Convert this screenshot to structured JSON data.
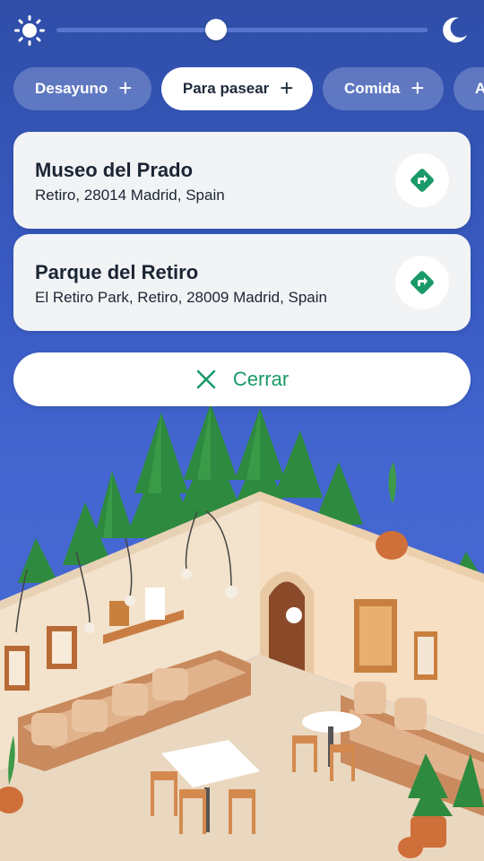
{
  "theme": {
    "accent": "#1a9a68",
    "sun_icon": "sun-icon",
    "moon_icon": "moon-icon",
    "brightness_level": 0.43
  },
  "chips": [
    {
      "label": "Desayuno",
      "active": false
    },
    {
      "label": "Para pasear",
      "active": true
    },
    {
      "label": "Comida",
      "active": false
    },
    {
      "label": "Ape",
      "active": false
    }
  ],
  "places": [
    {
      "name": "Museo del Prado",
      "address": "Retiro, 28014 Madrid, Spain",
      "icon": "directions-icon"
    },
    {
      "name": "Parque del Retiro",
      "address": "El Retiro Park, Retiro, 28009 Madrid, Spain",
      "icon": "directions-icon"
    }
  ],
  "close_button": {
    "label": "Cerrar",
    "icon": "close-icon"
  }
}
